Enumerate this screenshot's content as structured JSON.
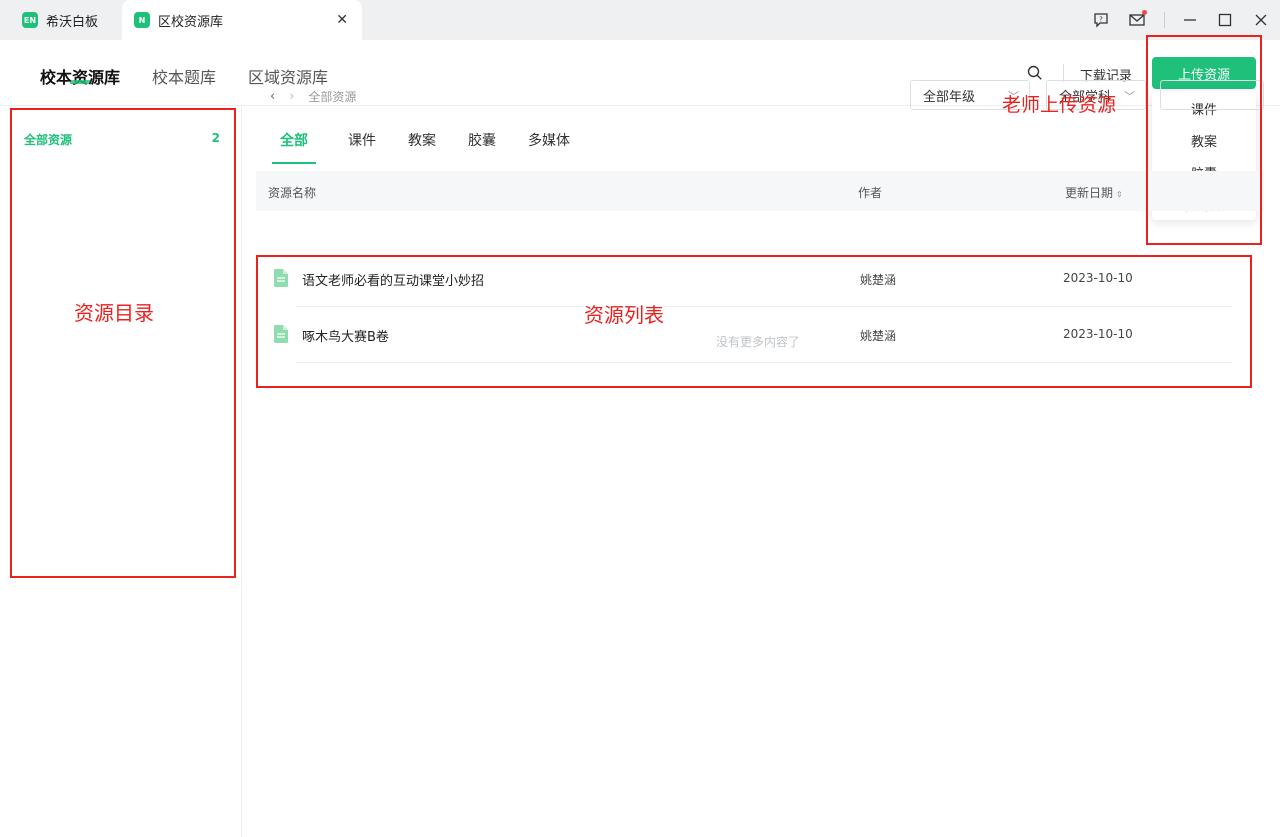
{
  "titlebar": {
    "tabs": [
      {
        "badge": "EN",
        "label": "希沃白板"
      },
      {
        "badge": "N",
        "label": "区校资源库"
      }
    ],
    "close_label": "✕"
  },
  "nav": {
    "tabs": [
      "校本资源库",
      "校本题库",
      "区域资源库"
    ],
    "download_label": "下载记录",
    "upload_label": "上传资源",
    "upload_menu": [
      "课件",
      "教案",
      "胶囊",
      "多媒体"
    ]
  },
  "sidebar": {
    "items": [
      {
        "label": "全部资源",
        "count": "2"
      }
    ]
  },
  "main": {
    "breadcrumb": "全部资源",
    "filters": {
      "grade": "全部年级",
      "subject": "全部学科"
    },
    "tabs": [
      "全部",
      "课件",
      "教案",
      "胶囊",
      "多媒体"
    ],
    "columns": {
      "name": "资源名称",
      "author": "作者",
      "date": "更新日期"
    },
    "rows": [
      {
        "name": "语文老师必看的互动课堂小妙招",
        "author": "姚楚涵",
        "date": "2023-10-10"
      },
      {
        "name": "啄木鸟大赛B卷",
        "author": "姚楚涵",
        "date": "2023-10-10"
      }
    ],
    "end_text": "没有更多内容了"
  },
  "annotations": {
    "catalog": "资源目录",
    "list": "资源列表",
    "upload": "老师上传资源"
  },
  "colors": {
    "accent": "#1ec07a",
    "annotation": "#e8231f"
  }
}
